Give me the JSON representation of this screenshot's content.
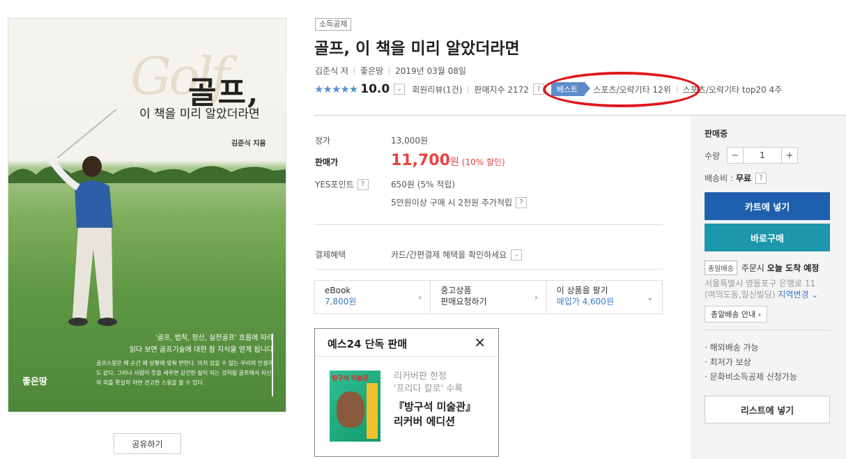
{
  "cover": {
    "script_word": "Golf",
    "title_big": "골프,",
    "title_sub": "이 책을 미리 알았더라면",
    "author": "김준식 지음",
    "quote_line1": "'골프, 법칙, 정신, 실전골프' 흐름에 따라",
    "quote_line2": "읽다 보면 골프기술에 대한 참 지식을 얻게 됩니다",
    "desc": "골프스윙은 매 순간 매 상황에 맞춰 변한다. 미처 잡을 수 없는 우리의 인생과도 같다. 그러나 사람이 뜻을 세우면 강건한 삶이 되는 것처럼 골프에서 자신의 의를 확실히 하면 견고한 스윙을 할 수 있다.",
    "publisher": "좋은땅"
  },
  "share_label": "공유하기",
  "badge": "소득공제",
  "title": "골프, 이 책을 미리 알았더라면",
  "meta": {
    "author": "김준식 저",
    "publisher": "좋은땅",
    "date": "2019년 03월 08일"
  },
  "rating": {
    "stars": "★★★★★",
    "score": "10.0",
    "dropdown_icon": "⌄",
    "review": "회원리뷰(1건)",
    "sales_index": "판매지수 2172",
    "help": "?",
    "best_tag": "베스트",
    "rank": "스포츠/오락기타 12위",
    "rank2": "스포츠/오락기타 top20 4주"
  },
  "price": {
    "list_label": "정가",
    "list_value": "13,000원",
    "sale_label": "판매가",
    "sale_value": "11,700",
    "sale_unit": "원",
    "discount": "(10% 할인)",
    "point_label": "YES포인트",
    "point_value": "650원 (5% 적립)",
    "extra_point": "5만원이상 구매 시 2천원 추가적립",
    "payment_label": "결제혜택",
    "payment_value": "카드/간편결제 혜택을 확인하세요"
  },
  "options": [
    {
      "title": "eBook",
      "value": "7,800원",
      "arrow": "›"
    },
    {
      "title": "중고상품",
      "value": "판매요청하기",
      "arrow": "›"
    },
    {
      "title": "이 상품을 팔기",
      "value": "매입가 4,600원",
      "arrow": "⌄"
    }
  ],
  "promo": {
    "header": "예스24 단독 판매",
    "close": "✕",
    "cover_title": "방구석 미술관",
    "line1": "리커버판 한정",
    "line2": "'프리다 칼로' 수록",
    "strong1": "『방구석 미술관』",
    "strong2": "리커버 에디션"
  },
  "side": {
    "status": "판매중",
    "qty_label": "수량",
    "qty_minus": "−",
    "qty_value": "1",
    "qty_plus": "+",
    "shipping_label": "배송비 :",
    "shipping_value": "무료",
    "cart": "카트에 넣기",
    "buy": "바로구매",
    "deliv_tag": "총알배송",
    "deliv_prefix": "주문시",
    "deliv_strong": "오늘 도착 예정",
    "addr1": "서울특별시 영등포구 은행로 11",
    "addr2": "(여의도동,일신빌딩)",
    "addr_change": "지역변경 ⌄",
    "deliv_guide": "총알배송 안내 ›",
    "list": [
      "· 해외배송 가능",
      "· 최저가 보상",
      "· 문화비소득공제 신청가능"
    ],
    "wishlist": "리스트에 넣기"
  },
  "colors": {
    "accent_blue": "#1e5fae",
    "teal": "#1c97ab",
    "price_red": "#e94340",
    "highlight_red": "#e0171c"
  }
}
